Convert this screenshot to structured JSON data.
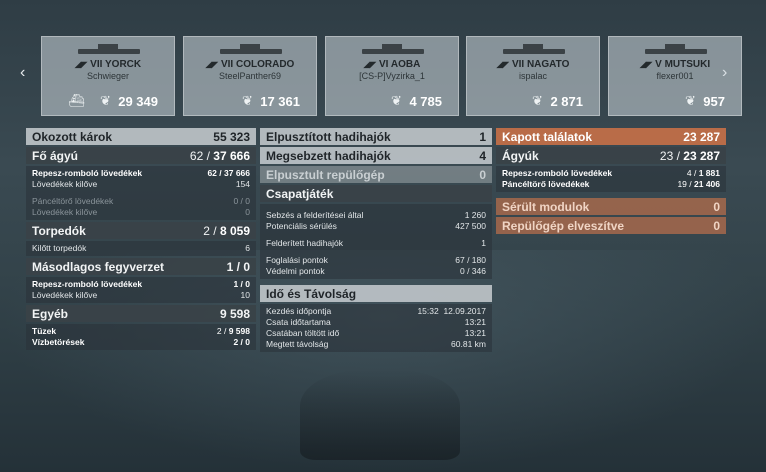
{
  "cards": [
    {
      "tier": "VII",
      "ship": "YORCK",
      "player": "Schwieger",
      "score": "29 349",
      "sunk": true
    },
    {
      "tier": "VII",
      "ship": "COLORADO",
      "player": "SteelPanther69",
      "score": "17 361",
      "sunk": false
    },
    {
      "tier": "VI",
      "ship": "AOBA",
      "player": "[CS-P]Vyzirka_1",
      "score": "4 785",
      "sunk": false
    },
    {
      "tier": "VII",
      "ship": "NAGATO",
      "player": "ispalac",
      "score": "2 871",
      "sunk": false
    },
    {
      "tier": "V",
      "ship": "MUTSUKI",
      "player": "flexer001",
      "score": "957",
      "sunk": false
    }
  ],
  "left": {
    "okozott": {
      "label": "Okozott károk",
      "value": "55 323"
    },
    "fo_agyu": {
      "label": "Fő ágyú",
      "hits": "62",
      "total": "37 666"
    },
    "fo_rows": [
      {
        "label": "Repesz-romboló lövedékek",
        "hits": "62",
        "total": "37 666"
      },
      {
        "label": "Lövedékek kilőve",
        "value": "154"
      }
    ],
    "fo_rows2": [
      {
        "label": "Páncéltörő lövedékek",
        "value": "0 / 0"
      },
      {
        "label": "Lövedékek kilőve",
        "value": "0"
      }
    ],
    "torpedok": {
      "label": "Torpedók",
      "hits": "2",
      "total": "8 059"
    },
    "torp_rows": [
      {
        "label": "Kilőtt torpedók",
        "value": "6"
      }
    ],
    "masodlagos": {
      "label": "Másodlagos fegyverzet",
      "value": "1 / 0"
    },
    "mas_rows": [
      {
        "label": "Repesz-romboló lövedékek",
        "value": "1 / 0"
      },
      {
        "label": "Lövedékek kilőve",
        "value": "10"
      }
    ],
    "egyeb": {
      "label": "Egyéb",
      "value": "9 598"
    },
    "egyeb_rows": [
      {
        "label": "Tüzek",
        "hits": "2",
        "total": "9 598"
      },
      {
        "label": "Vízbetörések",
        "value": "2 / 0"
      }
    ]
  },
  "mid": {
    "elpusztitott": {
      "label": "Elpusztított hadihajók",
      "value": "1"
    },
    "megsebzett": {
      "label": "Megsebzett hadihajók",
      "value": "4"
    },
    "repulogep": {
      "label": "Elpusztult repülőgép",
      "value": "0"
    },
    "csapatjatek": {
      "label": "Csapatjáték"
    },
    "csap_rows": [
      {
        "label": "Sebzés a felderítései által",
        "value": "1 260"
      },
      {
        "label": "Potenciális sérülés",
        "value": "427 500"
      }
    ],
    "csap_rows2": [
      {
        "label": "Felderített hadihajók",
        "value": "1"
      }
    ],
    "csap_rows3": [
      {
        "label": "Foglalási pontok",
        "value": "67 / 180"
      },
      {
        "label": "Védelmi pontok",
        "value": "0 / 346"
      }
    ],
    "ido": {
      "label": "Idő és Távolság"
    },
    "ido_rows": [
      {
        "label": "Kezdés időpontja",
        "value": "15:32  12.09.2017"
      },
      {
        "label": "Csata időtartama",
        "value": "13:21"
      },
      {
        "label": "Csatában töltött idő",
        "value": "13:21"
      },
      {
        "label": "Megtett távolság",
        "value": "60.81 km"
      }
    ]
  },
  "right": {
    "kapott": {
      "label": "Kapott találatok",
      "value": "23 287"
    },
    "agyuk": {
      "label": "Ágyúk",
      "hits": "23",
      "total": "23 287"
    },
    "ag_rows": [
      {
        "label": "Repesz-romboló lövedékek",
        "hits": "4",
        "total": "1 881"
      },
      {
        "label": "Páncéltörő lövedékek",
        "hits": "19",
        "total": "21 406"
      }
    ],
    "serult": {
      "label": "Sérült modulok",
      "value": "0"
    },
    "repgep": {
      "label": "Repülőgép elveszítve",
      "value": "0"
    }
  }
}
